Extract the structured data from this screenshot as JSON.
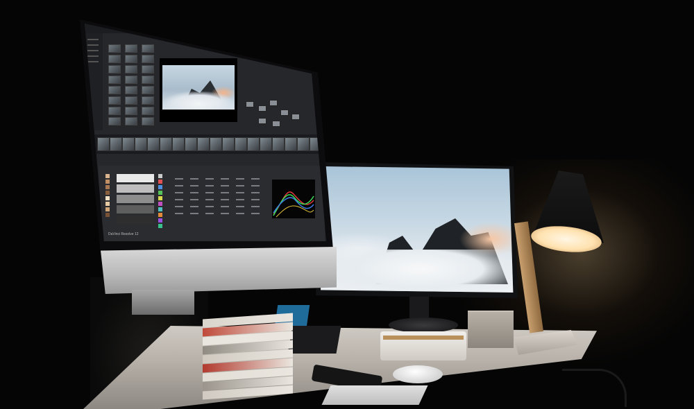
{
  "scene": {
    "description_tags": [
      "imac-workstation",
      "secondary-monitor",
      "desk-lamp",
      "desk"
    ]
  },
  "imac": {
    "status_label": "DaVinci Resolve 12",
    "colors": {
      "ui_bg": "#26272b",
      "chin": "#c8c8c8"
    }
  },
  "monitor": {
    "colors": {
      "sky": "#b7cddd",
      "mountain": "#1f2327"
    }
  },
  "lamp": {
    "colors": {
      "light": "#ffe2b0",
      "wood": "#c89f6e"
    }
  },
  "books": {
    "spine_colors": [
      "#d9d4cc",
      "#c04a3a",
      "#e9e6e0",
      "#8f8a82",
      "#cfc9c0",
      "#b23a2e",
      "#e2ddd5",
      "#9a948c",
      "#d0cac2"
    ]
  },
  "swatches": {
    "big": [
      "#e9e9e9",
      "#bdbdbd",
      "#8d8d8d",
      "#5e5e5e",
      "#2e2e2e"
    ],
    "small": [
      "#d9b48f",
      "#c28e63",
      "#a87952",
      "#8a5f3d",
      "#f2e1c5",
      "#e6cba5",
      "#d0a679",
      "#7a5236",
      "#c9c9c9",
      "#e05050",
      "#4f8fe0",
      "#56c25a",
      "#d8d84e",
      "#c050c0",
      "#50c0c0",
      "#e08a3a",
      "#9a50e0",
      "#3ac08a"
    ]
  }
}
